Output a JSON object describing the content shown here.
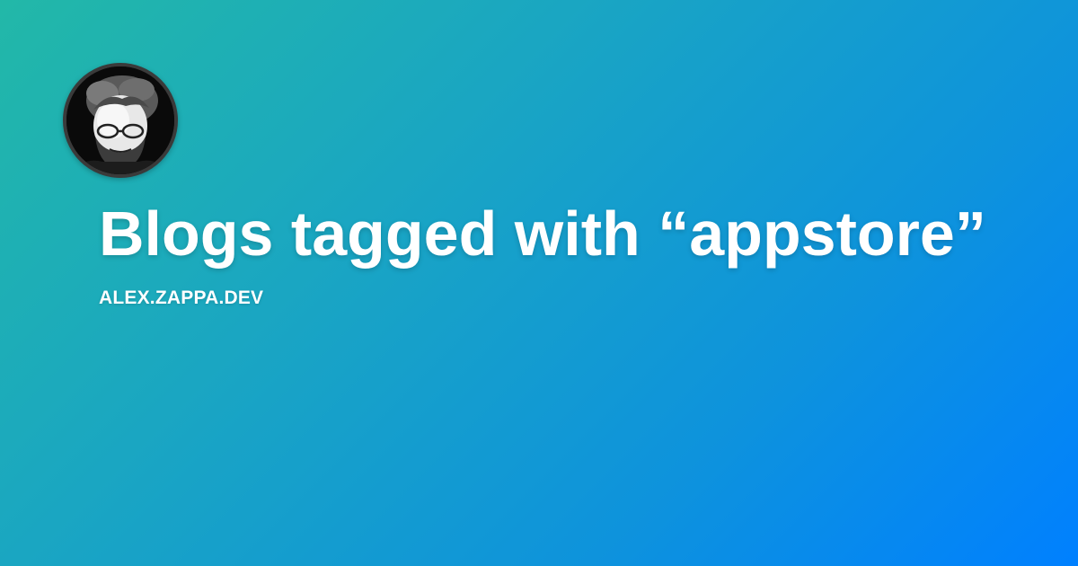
{
  "card": {
    "title": "Blogs tagged with “appstore”",
    "site": "ALEX.ZAPPA.DEV",
    "avatar_icon": "author-avatar-photo"
  },
  "colors": {
    "gradient_start": "#22b8a8",
    "gradient_end": "#0080ff",
    "text": "#ffffff"
  }
}
